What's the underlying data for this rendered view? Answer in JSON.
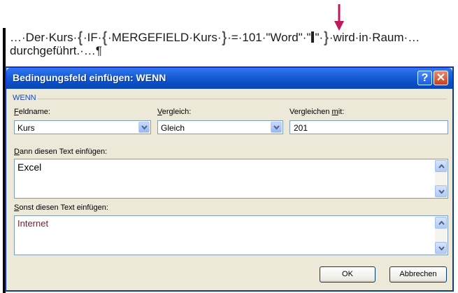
{
  "document": {
    "line1_a": "…·Der·Kurs·",
    "line1_b": "·IF·",
    "line1_c": "·MERGEFIELD·Kurs·",
    "line1_d": "·=·101·\"Word\"·\"",
    "line1_e": "\"·",
    "line1_f": "·wird·in·Raum·…",
    "line2": "durchgeführt.·…¶",
    "field_brace_open": "{",
    "field_brace_close": "}"
  },
  "dialog": {
    "title": "Bedingungsfeld einfügen: WENN",
    "help_label": "?",
    "close_label": "✕",
    "group_label": "WENN",
    "fieldname": {
      "label_underlined": "F",
      "label_rest": "eldname:",
      "value": "Kurs"
    },
    "comparison": {
      "label_underlined": "V",
      "label_rest": "ergleich:",
      "value": "Gleich"
    },
    "compare_with": {
      "label_pre": "Vergleichen ",
      "label_underlined": "m",
      "label_rest": "it:",
      "value": "201"
    },
    "then_text": {
      "label_underlined": "D",
      "label_rest": "ann diesen Text einfügen:",
      "value": "Excel"
    },
    "else_text": {
      "label_underlined": "S",
      "label_rest": "onst diesen Text einfügen:",
      "value": "Internet"
    },
    "ok_label": "OK",
    "cancel_label": "Abbrechen"
  },
  "colors": {
    "arrow": "#c2185b",
    "titlebar": "#0b50c8",
    "dialog_bg": "#ece9d8",
    "group_label": "#1546c5"
  },
  "icons": [
    "arrow-down-icon",
    "help-icon",
    "close-icon",
    "chevron-down-icon",
    "scroll-up-icon",
    "scroll-down-icon"
  ]
}
